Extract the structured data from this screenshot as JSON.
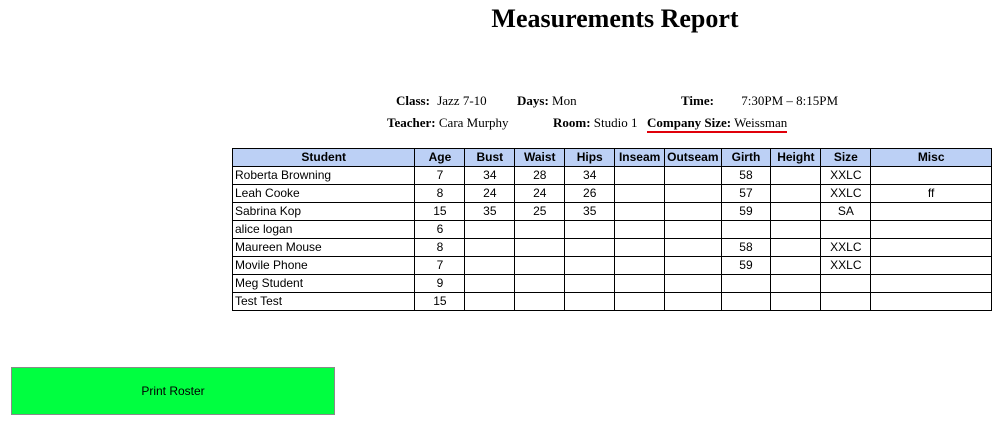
{
  "page": {
    "title": "Measurements Report"
  },
  "info": {
    "class_label": "Class:",
    "class_value": "Jazz 7-10",
    "days_label": "Days:",
    "days_value": "Mon",
    "time_label": "Time:",
    "time_value": "7:30PM – 8:15PM",
    "teacher_label": "Teacher:",
    "teacher_value": "Cara Murphy",
    "room_label": "Room:",
    "room_value": "Studio 1",
    "company_label": "Company Size:",
    "company_value": "Weissman"
  },
  "table": {
    "headers": [
      "Student",
      "Age",
      "Bust",
      "Waist",
      "Hips",
      "Inseam",
      "Outseam",
      "Girth",
      "Height",
      "Size",
      "Misc"
    ],
    "rows": [
      [
        "Roberta Browning",
        "7",
        "34",
        "28",
        "34",
        "",
        "",
        "58",
        "",
        "XXLC",
        ""
      ],
      [
        "Leah Cooke",
        "8",
        "24",
        "24",
        "26",
        "",
        "",
        "57",
        "",
        "XXLC",
        "ff"
      ],
      [
        "Sabrina Kop",
        "15",
        "35",
        "25",
        "35",
        "",
        "",
        "59",
        "",
        "SA",
        ""
      ],
      [
        "alice logan",
        "6",
        "",
        "",
        "",
        "",
        "",
        "",
        "",
        "",
        ""
      ],
      [
        "Maureen Mouse",
        "8",
        "",
        "",
        "",
        "",
        "",
        "58",
        "",
        "XXLC",
        ""
      ],
      [
        "Movile Phone",
        "7",
        "",
        "",
        "",
        "",
        "",
        "59",
        "",
        "XXLC",
        ""
      ],
      [
        "Meg Student",
        "9",
        "",
        "",
        "",
        "",
        "",
        "",
        "",
        "",
        ""
      ],
      [
        "Test Test",
        "15",
        "",
        "",
        "",
        "",
        "",
        "",
        "",
        "",
        ""
      ]
    ]
  },
  "actions": {
    "print_label": "Print Roster"
  }
}
